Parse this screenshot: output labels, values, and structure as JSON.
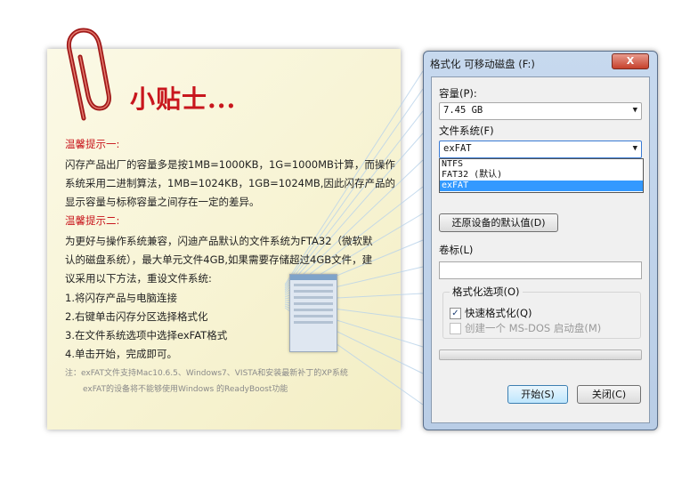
{
  "tip": {
    "title": "小贴士...",
    "head1": "温馨提示一:",
    "p1_lines": [
      "闪存产品出厂的容量多是按1MB=1000KB，1G=1000MB计算，而操作",
      "系统采用二进制算法，1MB=1024KB，1GB=1024MB,因此闪存产品的",
      "显示容量与标称容量之间存在一定的差异。"
    ],
    "head2": "温馨提示二:",
    "p2_lines": [
      "为更好与操作系统兼容，闪迪产品默认的文件系统为FTA32（微软默",
      "认的磁盘系统），最大单元文件4GB,如果需要存储超过4GB文件，建",
      "议采用以下方法，重设文件系统:"
    ],
    "steps": [
      "1.将闪存产品与电脑连接",
      "2.右键单击闪存分区选择格式化",
      "3.在文件系统选项中选择exFAT格式",
      "4.单击开始，完成即可。"
    ],
    "note1": "注：exFAT文件支持Mac10.6.5、Windows7、VISTA和安装最新补丁的XP系统",
    "note2": "exFAT的设备将不能够使用Windows 的ReadyBoost功能"
  },
  "dialog": {
    "title": "格式化 可移动磁盘 (F:)",
    "close": "X",
    "capacity_label": "容量(P):",
    "capacity_value": "7.45 GB",
    "fs_label": "文件系统(F)",
    "fs_value": "exFAT",
    "fs_options": [
      "NTFS",
      "FAT32 (默认)",
      "exFAT"
    ],
    "fs_selected": "exFAT",
    "restore_button": "还原设备的默认值(D)",
    "volume_label": "卷标(L)",
    "volume_value": "",
    "options_group": "格式化选项(O)",
    "quick_format": "快速格式化(Q)",
    "quick_format_checked": true,
    "msdos_disk": "创建一个 MS-DOS 启动盘(M)",
    "msdos_checked": false,
    "progress": 0,
    "start_button": "开始(S)",
    "close_button": "关闭(C)"
  },
  "icons": {
    "paperclip": "paperclip-icon",
    "dropdown_arrow": "▼",
    "check": "✓"
  }
}
